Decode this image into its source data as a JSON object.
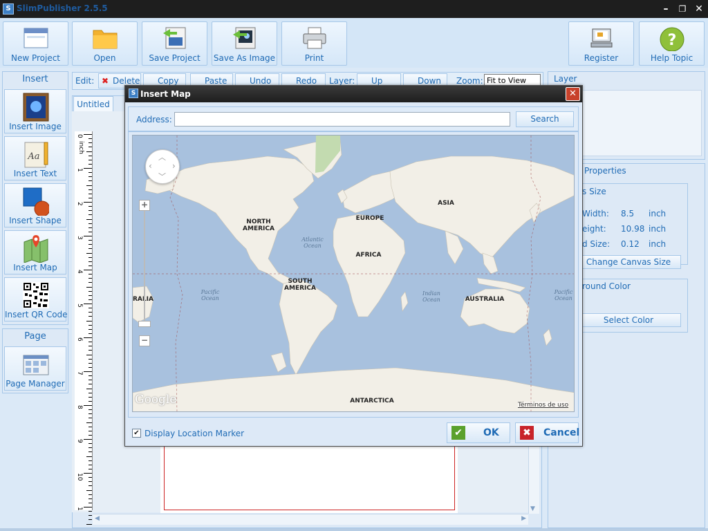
{
  "window": {
    "title": "SlimPublisher 2.5.5",
    "icon_letter": "S"
  },
  "toolbar": {
    "buttons": [
      {
        "label": "New Project",
        "icon": "new-project-icon"
      },
      {
        "label": "Open",
        "icon": "folder-icon"
      },
      {
        "label": "Save Project",
        "icon": "save-project-icon"
      },
      {
        "label": "Save As Image",
        "icon": "save-image-icon"
      },
      {
        "label": "Print",
        "icon": "printer-icon"
      }
    ],
    "right_buttons": [
      {
        "label": "Register",
        "icon": "register-icon"
      },
      {
        "label": "Help Topic",
        "icon": "help-icon"
      }
    ]
  },
  "left_panel": {
    "insert_heading": "Insert",
    "items": [
      {
        "label": "Insert Image",
        "icon": "image-icon"
      },
      {
        "label": "Insert Text",
        "icon": "text-icon"
      },
      {
        "label": "Insert Shape",
        "icon": "shape-icon"
      },
      {
        "label": "Insert Map",
        "icon": "map-icon"
      },
      {
        "label": "Insert QR Code",
        "icon": "qr-code-icon"
      }
    ],
    "page_heading": "Page",
    "page_manager": "Page Manager"
  },
  "editbar": {
    "edit_label": "Edit:",
    "delete": "Delete",
    "copy": "Copy",
    "paste": "Paste",
    "undo": "Undo",
    "redo": "Redo",
    "layer_label": "Layer:",
    "up": "Up",
    "down": "Down",
    "zoom_label": "Zoom:",
    "zoom_value": "Fit to View"
  },
  "document": {
    "tab": "Untitled",
    "ruler_unit": "inch",
    "ruler_marks": [
      "0",
      "1",
      "2",
      "3",
      "4",
      "5",
      "6",
      "7",
      "8",
      "9",
      "10",
      "1"
    ]
  },
  "right_panel": {
    "layer_heading": "Layer",
    "properties_heading": "Properties",
    "canvas_size_heading": "s Size",
    "width_label": "Width:",
    "width_value": "8.5",
    "width_unit": "inch",
    "height_label": "eight:",
    "height_value": "10.98",
    "height_unit": "inch",
    "grid_label": "d Size:",
    "grid_value": "0.12",
    "grid_unit": "inch",
    "change_canvas": "Change Canvas Size",
    "background_heading": "round Color",
    "select_color": "Select Color"
  },
  "dialog": {
    "title": "Insert Map",
    "address_label": "Address:",
    "address_value": "",
    "search": "Search",
    "map": {
      "continents": [
        "NORTH AMERICA",
        "SOUTH AMERICA",
        "EUROPE",
        "AFRICA",
        "ASIA",
        "AUSTRALIA",
        "ANTARCTICA",
        "RALIA"
      ],
      "oceans": [
        "Atlantic Ocean",
        "Pacific Ocean",
        "Indian Ocean",
        "Pacific Ocean"
      ],
      "logo": "Google",
      "terms": "Términos de uso"
    },
    "display_marker_label": "Display Location Marker",
    "display_marker_checked": true,
    "ok": "OK",
    "cancel": "Cancel"
  }
}
